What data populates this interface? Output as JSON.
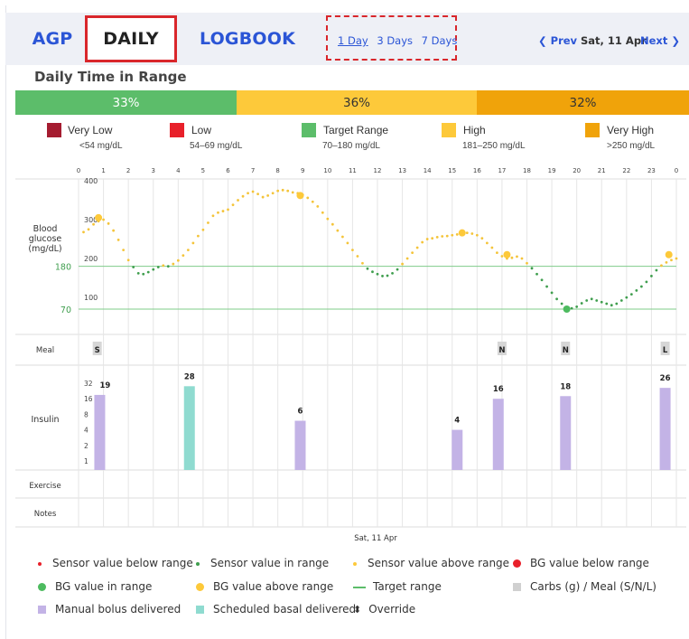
{
  "tabs": [
    {
      "label": "AGP",
      "active": false
    },
    {
      "label": "DAILY",
      "active": true
    },
    {
      "label": "LOGBOOK",
      "active": false
    }
  ],
  "range_options": [
    {
      "label": "1 Day",
      "selected": true
    },
    {
      "label": "3 Days",
      "selected": false
    },
    {
      "label": "7 Days",
      "selected": false
    }
  ],
  "nav": {
    "prev_label": "❮ Prev",
    "date": "Sat, 11 Apr",
    "next_label": "Next ❯"
  },
  "section_title": "Daily Time in Range",
  "time_in_range": [
    {
      "label": "33%",
      "percent": 33,
      "color": "#5cbd6a"
    },
    {
      "label": "36%",
      "percent": 36,
      "color": "#fdc93a"
    },
    {
      "label": "32%",
      "percent": 32,
      "color": "#f0a30a"
    }
  ],
  "range_legend": [
    {
      "label": "Very Low",
      "sub": "<54 mg/dL",
      "color": "#a51c30"
    },
    {
      "label": "Low",
      "sub": "54–69 mg/dL",
      "color": "#e8202a"
    },
    {
      "label": "Target Range",
      "sub": "70–180 mg/dL",
      "color": "#5cbd6a"
    },
    {
      "label": "High",
      "sub": "181–250 mg/dL",
      "color": "#fdc93a"
    },
    {
      "label": "Very High",
      "sub": ">250 mg/dL",
      "color": "#f0a30a"
    }
  ],
  "chart_data": {
    "type": "scatter",
    "x_ticks": [
      "0",
      "1",
      "2",
      "3",
      "4",
      "5",
      "6",
      "7",
      "8",
      "9",
      "10",
      "11",
      "12",
      "13",
      "14",
      "15",
      "16",
      "17",
      "18",
      "19",
      "20",
      "21",
      "22",
      "23",
      "0"
    ],
    "xlabel": "Sat, 11 Apr",
    "ylabel": "Blood glucose (mg/dL)",
    "y_ticks": [
      "400",
      "300",
      "200",
      "100"
    ],
    "target_lines": [
      {
        "label": "180",
        "value": 180
      },
      {
        "label": "70",
        "value": 70
      }
    ],
    "ylim": [
      0,
      400
    ],
    "sensor_values": [
      [
        0.2,
        268
      ],
      [
        0.4,
        275
      ],
      [
        0.6,
        288
      ],
      [
        0.8,
        296
      ],
      [
        1.0,
        300
      ],
      [
        1.2,
        290
      ],
      [
        1.4,
        272
      ],
      [
        1.6,
        248
      ],
      [
        1.8,
        222
      ],
      [
        2.0,
        196
      ],
      [
        2.2,
        178
      ],
      [
        2.4,
        162
      ],
      [
        2.6,
        160
      ],
      [
        2.8,
        165
      ],
      [
        3.0,
        172
      ],
      [
        3.2,
        178
      ],
      [
        3.4,
        182
      ],
      [
        3.6,
        180
      ],
      [
        3.8,
        186
      ],
      [
        4.0,
        195
      ],
      [
        4.2,
        208
      ],
      [
        4.4,
        222
      ],
      [
        4.6,
        240
      ],
      [
        4.8,
        258
      ],
      [
        5.0,
        274
      ],
      [
        5.2,
        292
      ],
      [
        5.4,
        310
      ],
      [
        5.6,
        318
      ],
      [
        5.8,
        322
      ],
      [
        6.0,
        326
      ],
      [
        6.2,
        338
      ],
      [
        6.4,
        350
      ],
      [
        6.6,
        360
      ],
      [
        6.8,
        368
      ],
      [
        7.0,
        372
      ],
      [
        7.2,
        366
      ],
      [
        7.4,
        358
      ],
      [
        7.6,
        362
      ],
      [
        7.8,
        368
      ],
      [
        8.0,
        374
      ],
      [
        8.2,
        376
      ],
      [
        8.4,
        374
      ],
      [
        8.6,
        370
      ],
      [
        8.8,
        368
      ],
      [
        9.0,
        364
      ],
      [
        9.2,
        356
      ],
      [
        9.4,
        346
      ],
      [
        9.6,
        334
      ],
      [
        9.8,
        318
      ],
      [
        10.0,
        302
      ],
      [
        10.2,
        288
      ],
      [
        10.4,
        272
      ],
      [
        10.6,
        256
      ],
      [
        10.8,
        240
      ],
      [
        11.0,
        222
      ],
      [
        11.2,
        206
      ],
      [
        11.4,
        188
      ],
      [
        11.6,
        174
      ],
      [
        11.8,
        166
      ],
      [
        12.0,
        160
      ],
      [
        12.2,
        155
      ],
      [
        12.4,
        156
      ],
      [
        12.6,
        162
      ],
      [
        12.8,
        172
      ],
      [
        13.0,
        186
      ],
      [
        13.2,
        200
      ],
      [
        13.4,
        215
      ],
      [
        13.6,
        228
      ],
      [
        13.8,
        242
      ],
      [
        14.0,
        250
      ],
      [
        14.2,
        252
      ],
      [
        14.4,
        255
      ],
      [
        14.6,
        257
      ],
      [
        14.8,
        258
      ],
      [
        15.0,
        260
      ],
      [
        15.2,
        262
      ],
      [
        15.4,
        265
      ],
      [
        15.6,
        266
      ],
      [
        15.8,
        264
      ],
      [
        16.0,
        260
      ],
      [
        16.2,
        252
      ],
      [
        16.4,
        240
      ],
      [
        16.6,
        228
      ],
      [
        16.8,
        215
      ],
      [
        17.0,
        206
      ],
      [
        17.2,
        200
      ],
      [
        17.4,
        202
      ],
      [
        17.6,
        205
      ],
      [
        17.8,
        200
      ],
      [
        18.0,
        188
      ],
      [
        18.2,
        175
      ],
      [
        18.4,
        160
      ],
      [
        18.6,
        145
      ],
      [
        18.8,
        128
      ],
      [
        19.0,
        112
      ],
      [
        19.2,
        96
      ],
      [
        19.4,
        84
      ],
      [
        19.6,
        75
      ],
      [
        19.8,
        72
      ],
      [
        20.0,
        76
      ],
      [
        20.2,
        85
      ],
      [
        20.4,
        92
      ],
      [
        20.6,
        96
      ],
      [
        20.8,
        92
      ],
      [
        21.0,
        88
      ],
      [
        21.2,
        84
      ],
      [
        21.4,
        80
      ],
      [
        21.6,
        84
      ],
      [
        21.8,
        92
      ],
      [
        22.0,
        100
      ],
      [
        22.2,
        108
      ],
      [
        22.4,
        118
      ],
      [
        22.6,
        128
      ],
      [
        22.8,
        140
      ],
      [
        23.0,
        155
      ],
      [
        23.2,
        170
      ],
      [
        23.4,
        182
      ],
      [
        23.6,
        190
      ],
      [
        23.8,
        196
      ],
      [
        24.0,
        200
      ]
    ],
    "bg_values": [
      [
        0.8,
        305
      ],
      [
        8.9,
        362
      ],
      [
        15.4,
        266
      ],
      [
        17.2,
        210
      ],
      [
        19.6,
        70
      ],
      [
        23.7,
        210
      ]
    ],
    "meal_markers": [
      {
        "hour": 0.75,
        "label": "S"
      },
      {
        "hour": 17.0,
        "label": "N"
      },
      {
        "hour": 19.55,
        "label": "N"
      },
      {
        "hour": 23.55,
        "label": "L"
      }
    ],
    "insulin_scale_labels": [
      "32",
      "16",
      "8",
      "4",
      "2",
      "1"
    ],
    "insulin": [
      {
        "hour": 0.85,
        "units": 19,
        "label": "19",
        "type": "manual"
      },
      {
        "hour": 4.45,
        "units": 28,
        "label": "28",
        "type": "basal"
      },
      {
        "hour": 8.9,
        "units": 6,
        "label": "6",
        "type": "manual"
      },
      {
        "hour": 15.2,
        "units": 4,
        "label": "4",
        "type": "manual"
      },
      {
        "hour": 16.85,
        "units": 16,
        "label": "16",
        "type": "manual"
      },
      {
        "hour": 19.55,
        "units": 18,
        "label": "18",
        "type": "manual"
      },
      {
        "hour": 23.55,
        "units": 26,
        "label": "26",
        "type": "manual"
      }
    ],
    "row_labels": {
      "meal": "Meal",
      "insulin": "Insulin",
      "exercise": "Exercise",
      "notes": "Notes"
    },
    "grid": true
  },
  "footer_legend": [
    {
      "label": "Sensor value below range",
      "icon": "small-red-dot-icon",
      "color": "#e8202a"
    },
    {
      "label": "Sensor value in range",
      "icon": "small-green-dot-icon",
      "color": "#3f9e4e"
    },
    {
      "label": "Sensor value above range",
      "icon": "small-yellow-dot-icon",
      "color": "#fdc93a"
    },
    {
      "label": "BG value below range",
      "icon": "red-dot-icon",
      "color": "#e8202a"
    },
    {
      "label": "BG value in range",
      "icon": "green-dot-icon",
      "color": "#4dbb5f"
    },
    {
      "label": "BG value above range",
      "icon": "yellow-dot-icon",
      "color": "#fdc93a"
    },
    {
      "label": "Target range",
      "icon": "green-line-icon",
      "color": "#5cbd6a"
    },
    {
      "label": "Carbs (g) / Meal (S/N/L)",
      "icon": "gray-square-icon",
      "color": "#d0d0d0"
    },
    {
      "label": "Manual bolus delivered",
      "icon": "purple-square-icon",
      "color": "#c3b3e6"
    },
    {
      "label": "Scheduled basal delivered",
      "icon": "teal-square-icon",
      "color": "#8fdbd0"
    },
    {
      "label": "Override",
      "icon": "up-down-arrow-icon",
      "color": "#333333"
    }
  ]
}
